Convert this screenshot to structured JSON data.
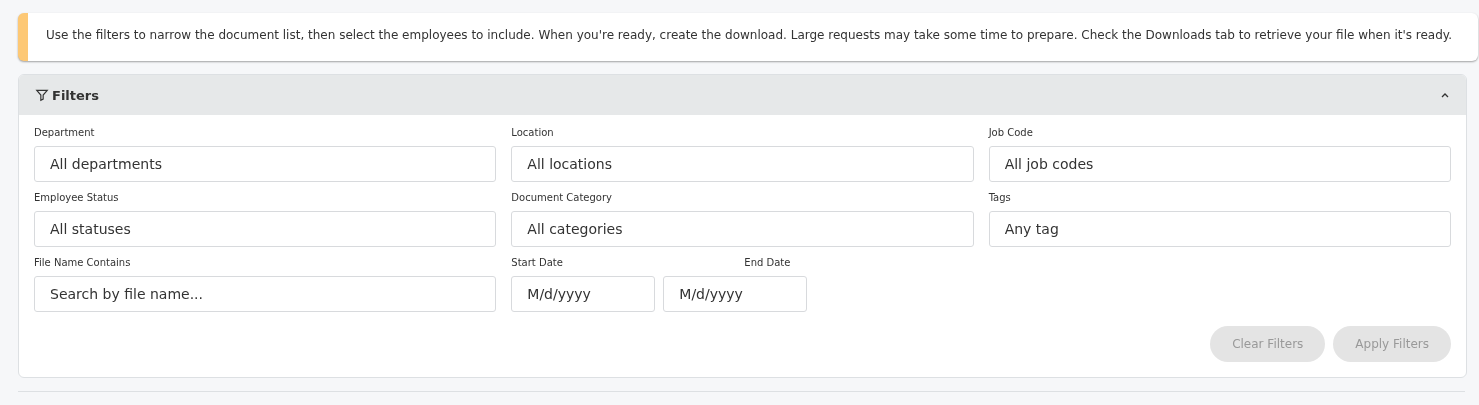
{
  "notice": {
    "text": "Use the filters to narrow the document list, then select the employees to include. When you're ready, create the download. Large requests may take some time to prepare. Check the Downloads tab to retrieve your file when it's ready."
  },
  "filters": {
    "title": "Filters",
    "expanded": true,
    "fields": [
      {
        "kind": "select",
        "label": "Department",
        "value": "All departments"
      },
      {
        "kind": "select",
        "label": "Location",
        "value": "All locations"
      },
      {
        "kind": "select",
        "label": "Job Code",
        "value": "All job codes"
      },
      {
        "kind": "select",
        "label": "Employee Status",
        "value": "All statuses"
      },
      {
        "kind": "select",
        "label": "Document Category",
        "value": "All categories"
      },
      {
        "kind": "select",
        "label": "Tags",
        "value": "Any tag"
      },
      {
        "kind": "text",
        "label": "File Name Contains",
        "placeholder": "Search by file name..."
      },
      {
        "kind": "daterange",
        "start": {
          "label": "Start Date",
          "placeholder": "M/d/yyyy"
        },
        "end": {
          "label": "End Date",
          "placeholder": "M/d/yyyy"
        }
      }
    ],
    "buttons": [
      {
        "label": "Clear Filters",
        "disabled": true
      },
      {
        "label": "Apply Filters",
        "disabled": true
      }
    ]
  }
}
